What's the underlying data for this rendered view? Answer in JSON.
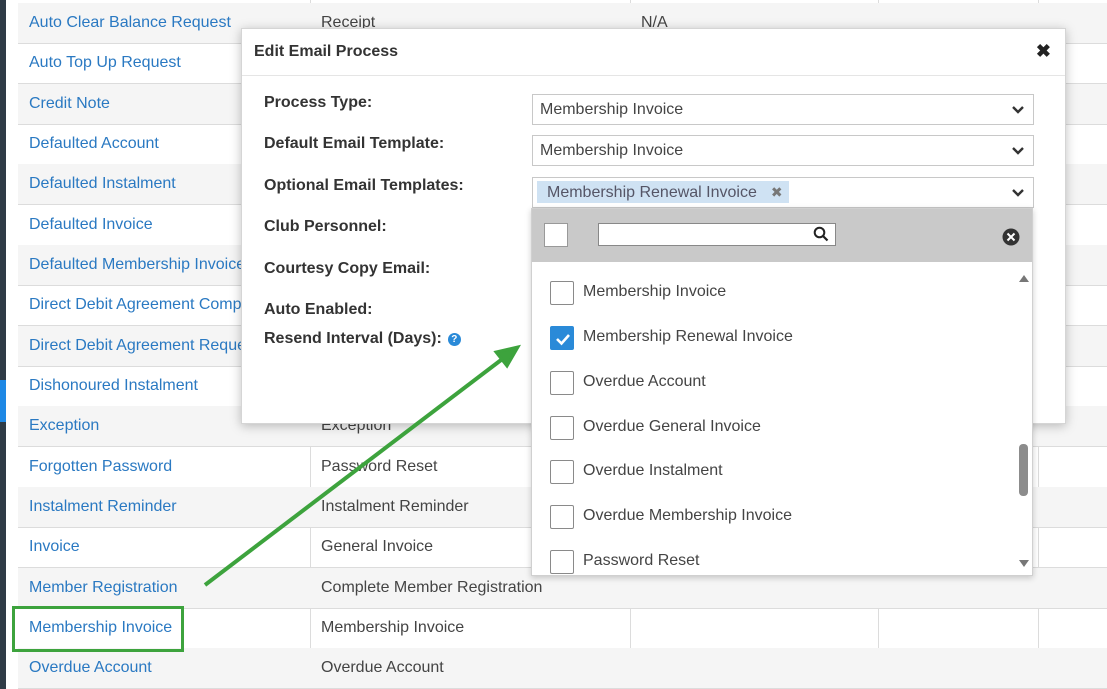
{
  "table": {
    "rows": [
      {
        "name": "Auto Clear Balance Request",
        "type": "Receipt",
        "extra": "N/A"
      },
      {
        "name": "Auto Top Up Request",
        "type": "",
        "extra": ""
      },
      {
        "name": "Credit Note",
        "type": "",
        "extra": ""
      },
      {
        "name": "Defaulted Account",
        "type": "",
        "extra": ""
      },
      {
        "name": "Defaulted Instalment",
        "type": "",
        "extra": ""
      },
      {
        "name": "Defaulted Invoice",
        "type": "",
        "extra": ""
      },
      {
        "name": "Defaulted Membership Invoice",
        "type": "",
        "extra": ""
      },
      {
        "name": "Direct Debit Agreement Compl",
        "type": "",
        "extra": ""
      },
      {
        "name": "Direct Debit Agreement Reque",
        "type": "",
        "extra": ""
      },
      {
        "name": "Dishonoured Instalment",
        "type": "",
        "extra": ""
      },
      {
        "name": "Exception",
        "type": "Exception",
        "extra": ""
      },
      {
        "name": "Forgotten Password",
        "type": "Password Reset",
        "extra": ""
      },
      {
        "name": "Instalment Reminder",
        "type": "Instalment Reminder",
        "extra": ""
      },
      {
        "name": "Invoice",
        "type": "General Invoice",
        "extra": ""
      },
      {
        "name": "Member Registration",
        "type": "Complete Member Registration",
        "extra": ""
      },
      {
        "name": "Membership Invoice",
        "type": "Membership Invoice",
        "extra": ""
      },
      {
        "name": "Overdue Account",
        "type": "Overdue Account",
        "extra": ""
      }
    ]
  },
  "modal": {
    "title": "Edit Email Process",
    "close_label": "✖",
    "fields": {
      "process_type_label": "Process Type:",
      "process_type_value": "Membership Invoice",
      "default_template_label": "Default Email Template:",
      "default_template_value": "Membership Invoice",
      "optional_templates_label": "Optional Email Templates:",
      "optional_templates_tag": "Membership Renewal Invoice",
      "tag_remove": "✖",
      "club_personnel_label": "Club Personnel:",
      "courtesy_copy_label": "Courtesy Copy Email:",
      "auto_enabled_label": "Auto Enabled:",
      "resend_interval_label": "Resend Interval (Days):",
      "help_glyph": "?"
    },
    "save_partial": "e"
  },
  "dropdown": {
    "options": [
      {
        "label": "Membership Invoice",
        "checked": false
      },
      {
        "label": "Membership Renewal Invoice",
        "checked": true
      },
      {
        "label": "Overdue Account",
        "checked": false
      },
      {
        "label": "Overdue General Invoice",
        "checked": false
      },
      {
        "label": "Overdue Instalment",
        "checked": false
      },
      {
        "label": "Overdue Membership Invoice",
        "checked": false
      },
      {
        "label": "Password Reset",
        "checked": false
      }
    ]
  },
  "colors": {
    "link": "#2a79c2",
    "accent": "#2a8ad8",
    "annotation": "#3da33d"
  }
}
